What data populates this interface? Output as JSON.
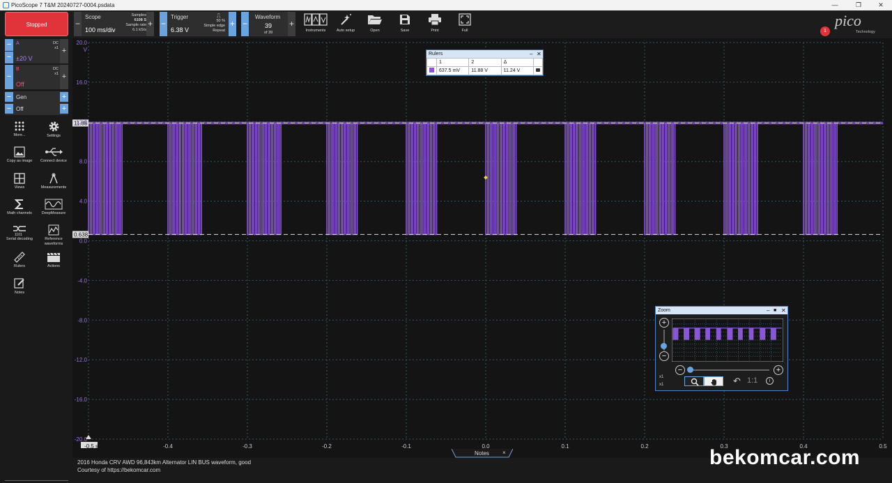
{
  "window": {
    "title": "PicoScope 7 T&M 20240727-0004.psdata",
    "controls": [
      "—",
      "❐",
      "✕"
    ]
  },
  "toolbar": {
    "run_state": "Stopped",
    "scope": {
      "label": "Scope",
      "value": "100 ms/div",
      "samples_label": "Samples",
      "samples_value": "6108 S",
      "rate_label": "Sample rate",
      "rate_value": "6.1 kS/s"
    },
    "trigger": {
      "label": "Trigger",
      "value": "6.38 V",
      "percent": "50 %",
      "mode": "Simple edge",
      "repeat": "Repeat"
    },
    "waveform": {
      "label": "Waveform",
      "value": "39",
      "of": "of 39"
    },
    "tools": [
      {
        "label": "Instruments",
        "icon": "instruments-icon"
      },
      {
        "label": "Auto setup",
        "icon": "auto-setup-icon"
      },
      {
        "label": "Open",
        "icon": "folder-open-icon"
      },
      {
        "label": "Save",
        "icon": "save-icon"
      },
      {
        "label": "Print",
        "icon": "print-icon"
      },
      {
        "label": "Full",
        "icon": "fullscreen-icon"
      }
    ],
    "alert_count": "1",
    "logo_text": "pico",
    "logo_sub": "Technology"
  },
  "channels": [
    {
      "name": "A",
      "value": "±20 V",
      "coupling": "DC",
      "probe": "x1",
      "name_color": "#9b6fe8",
      "value_color": "#b07cff"
    },
    {
      "name": "B",
      "value": "Off",
      "coupling": "DC",
      "probe": "x1",
      "name_color": "#ff4d7a",
      "value_color": "#ff4d7a"
    }
  ],
  "generator": {
    "label": "Gen",
    "state": "Off"
  },
  "left_tools": [
    {
      "label": "More...",
      "icon": "more-dots-icon"
    },
    {
      "label": "Settings",
      "icon": "gear-icon"
    },
    {
      "label": "Copy as image",
      "icon": "image-icon"
    },
    {
      "label": "Connect device",
      "icon": "usb-icon"
    },
    {
      "label": "Views",
      "icon": "grid-icon"
    },
    {
      "label": "Measurements",
      "icon": "measurements-icon"
    },
    {
      "label": "Math channels",
      "icon": "sigma-icon"
    },
    {
      "label": "DeepMeasure",
      "icon": "deepmeasure-icon"
    },
    {
      "label": "Serial decoding",
      "icon": "serial-decoding-icon"
    },
    {
      "label": "Reference waveforms",
      "icon": "reference-waveforms-icon"
    },
    {
      "label": "Rulers",
      "icon": "ruler-icon"
    },
    {
      "label": "Actions",
      "icon": "clapper-icon"
    },
    {
      "label": "Notes",
      "icon": "notes-icon"
    }
  ],
  "scope_view": {
    "y_ticks": [
      "20.0",
      "16.0",
      "12.0",
      "8.0",
      "4.0",
      "0.0",
      "-4.0",
      "-8.0",
      "-12.0",
      "-16.0",
      "-20.0"
    ],
    "y_unit": "V",
    "x_ticks": [
      "-0.5",
      "-0.4",
      "-0.3",
      "-0.2",
      "-0.1",
      "0.0",
      "0.1",
      "0.2",
      "0.3",
      "0.4",
      "0.5"
    ],
    "x_min_label": "-0.5",
    "x_unit": "s",
    "ruler_labels": [
      "11.88",
      "0.638"
    ],
    "trace_color": "#8a55d6",
    "grid_color": "#2a5a66"
  },
  "chart_data": {
    "type": "line",
    "x_range": [
      -0.5,
      0.5
    ],
    "ylim": [
      -20,
      20
    ],
    "grid": true,
    "series": [
      {
        "high_level_v": 11.88,
        "low_level_v": 0.638,
        "burst_centers_s": [
          -0.48,
          -0.38,
          -0.28,
          -0.18,
          -0.08,
          0.02,
          0.12,
          0.22,
          0.32,
          0.42
        ],
        "burst_width_s": 0.04,
        "pulse_spacing_s": 0.004
      }
    ],
    "rulers_v": [
      11.88,
      0.638
    ]
  },
  "rulers_window": {
    "title": "Rulers",
    "headers": [
      "1",
      "2",
      "Δ"
    ],
    "values": [
      "637.5 mV",
      "11.88 V",
      "11.24 V"
    ],
    "swatch_color": "#8a55d6"
  },
  "zoom_window": {
    "title": "Zoom",
    "x_scale": "x1",
    "y_scale": "x1",
    "reset_label": "1:1"
  },
  "notes": {
    "tab_label": "Notes",
    "close": "×",
    "lines": [
      "2016 Honda CRV AWD 96,843km Alternator LIN BUS waveform, good",
      "Courtesy of https://bekomcar.com"
    ]
  },
  "watermark": "bekomcar.com"
}
